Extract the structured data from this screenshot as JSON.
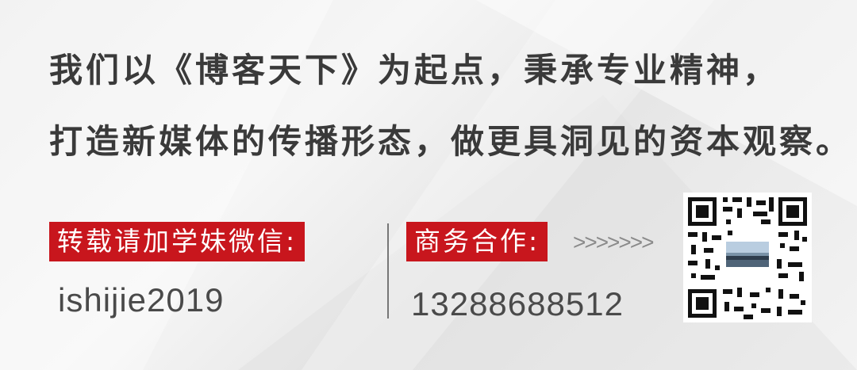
{
  "headline": {
    "line1": "我们以《博客天下》为起点，秉承专业精神，",
    "line2": "打造新媒体的传播形态，做更具洞见的资本观察。"
  },
  "repost": {
    "label": "转载请加学妹微信:",
    "wechat_id": "ishijie2019"
  },
  "business": {
    "label": "商务合作:",
    "arrows": ">>>>>>>",
    "phone": "13288688512"
  },
  "colors": {
    "accent_red": "#c8161d",
    "text_dark": "#3a3a3a",
    "background": "#ececec"
  },
  "icons": {
    "qr_code": "qr-code-image"
  }
}
